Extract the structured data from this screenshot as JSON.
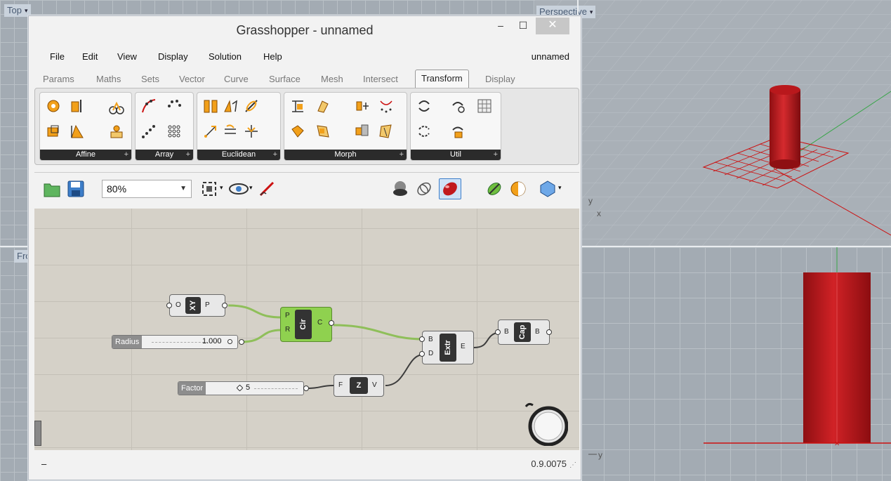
{
  "viewports": {
    "top": {
      "label": "Top"
    },
    "front": {
      "label": "Front"
    },
    "perspective": {
      "label": "Perspective"
    },
    "right": {
      "label": "y"
    }
  },
  "window": {
    "title": "Grasshopper - unnamed",
    "minimize": "–",
    "maximize": "☐",
    "close": "✕"
  },
  "menu": {
    "items": [
      "File",
      "Edit",
      "View",
      "Display",
      "Solution",
      "Help"
    ],
    "document": "unnamed"
  },
  "tabs": [
    "Params",
    "Maths",
    "Sets",
    "Vector",
    "Curve",
    "Surface",
    "Mesh",
    "Intersect",
    "Transform",
    "Display"
  ],
  "active_tab": "Transform",
  "ribbon_groups": [
    "Affine",
    "Array",
    "Euclidean",
    "Morph",
    "Util"
  ],
  "toolbar": {
    "zoom": "80%"
  },
  "canvas": {
    "xy_node": {
      "in": "O",
      "core": "XY",
      "out": "P"
    },
    "circle_node": {
      "in1": "P",
      "in2": "R",
      "core": "Cir",
      "out": "C"
    },
    "radius_slider": {
      "label": "Radius",
      "value": "1.000"
    },
    "extrude_node": {
      "in1": "B",
      "in2": "D",
      "core": "Extr",
      "out": "E"
    },
    "cap_node": {
      "in": "B",
      "core": "Cap",
      "out": "B"
    },
    "factor_slider": {
      "label": "Factor",
      "value": "5"
    },
    "z_node": {
      "in": "F",
      "core": "Z",
      "out": "V"
    }
  },
  "status": {
    "left": "–",
    "version": "0.9.0075"
  },
  "axis_labels": {
    "persp_y": "y",
    "persp_x": "x",
    "front_y": "y"
  },
  "colors": {
    "wire": "#8fbf5a",
    "cylinder": "#c1191e",
    "component_green": "#8fd14f"
  }
}
